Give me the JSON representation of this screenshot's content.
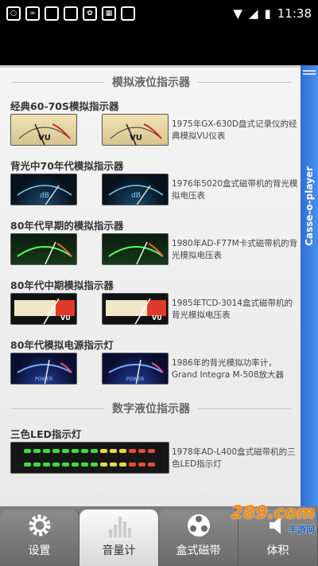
{
  "statusbar": {
    "time": "11:38"
  },
  "side_tab": {
    "label": "Casse-o-player"
  },
  "sections": [
    {
      "title": "模拟液位指示器",
      "groups": [
        {
          "title": "经典60-70S模拟指示器",
          "desc": "1975年GX-630D盘式记录仪的经典模拟VU仪表",
          "meter_label": "VU"
        },
        {
          "title": "背光中70年代模拟指示器",
          "desc": "1976年5020盒式磁带机的背光模拟电压表",
          "meter_label": "dB"
        },
        {
          "title": "80年代早期的模拟指示器",
          "desc": "1980年AD-F77M卡式磁带机的背光模拟电压表",
          "meter_label": ""
        },
        {
          "title": "80年代中期模拟指示器",
          "desc": "1985年TCD-3014盒式磁带机的背光模拟电压表",
          "meter_label": "VU"
        },
        {
          "title": "80年代模拟电源指示灯",
          "desc": "1986年的背光模拟功率计，Grand Integra M-508放大器",
          "meter_label": "POWER"
        }
      ]
    },
    {
      "title": "数字液位指示器",
      "groups": [
        {
          "title": "三色LED指示灯",
          "desc": "1978年AD-L400盒式磁带机的三色LED指示灯"
        }
      ]
    }
  ],
  "bottom_tabs": [
    {
      "label": "设置",
      "icon": "gear-icon",
      "active": false
    },
    {
      "label": "音量计",
      "icon": "level-meter-icon",
      "active": true
    },
    {
      "label": "盒式磁带",
      "icon": "reel-icon",
      "active": false
    },
    {
      "label": "体积",
      "icon": "volume-icon",
      "active": false
    }
  ],
  "watermark": {
    "text": "289.com",
    "sub": "手游网"
  },
  "colors": {
    "side_tab": "#3b7fe0",
    "bottom_bar": "#7d7d7d",
    "active_tab": "#f0f0f0"
  }
}
